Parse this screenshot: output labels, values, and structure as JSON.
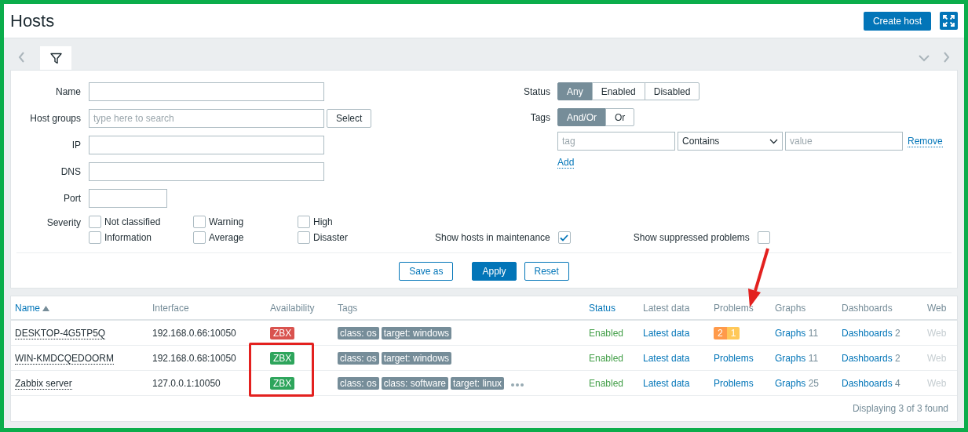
{
  "header": {
    "title": "Hosts",
    "create_button": "Create host"
  },
  "filter": {
    "fields": [
      {
        "label": "Name",
        "kind": "text"
      },
      {
        "label": "Host groups",
        "kind": "multiselect",
        "placeholder": "type here to search",
        "button": "Select"
      },
      {
        "label": "IP",
        "kind": "text"
      },
      {
        "label": "DNS",
        "kind": "text"
      },
      {
        "label": "Port",
        "kind": "short"
      }
    ],
    "severity": {
      "label": "Severity",
      "options": [
        {
          "label": "Not classified",
          "checked": false
        },
        {
          "label": "Warning",
          "checked": false
        },
        {
          "label": "High",
          "checked": false
        },
        {
          "label": "Information",
          "checked": false
        },
        {
          "label": "Average",
          "checked": false
        },
        {
          "label": "Disaster",
          "checked": false
        }
      ]
    },
    "status": {
      "label": "Status",
      "options": [
        {
          "label": "Any",
          "selected": true
        },
        {
          "label": "Enabled",
          "selected": false
        },
        {
          "label": "Disabled",
          "selected": false
        }
      ]
    },
    "tags": {
      "label": "Tags",
      "options": [
        {
          "label": "And/Or",
          "selected": true
        },
        {
          "label": "Or",
          "selected": false
        }
      ],
      "row": {
        "tag_placeholder": "tag",
        "operator": "Contains",
        "value_placeholder": "value",
        "remove": "Remove"
      },
      "add": "Add"
    },
    "maintenance": {
      "label": "Show hosts in maintenance",
      "checked": true
    },
    "suppressed": {
      "label": "Show suppressed problems",
      "checked": false
    },
    "buttons": [
      {
        "label": "Save as",
        "kind": "secondary"
      },
      {
        "label": "Apply",
        "kind": "primary"
      },
      {
        "label": "Reset",
        "kind": "secondary"
      }
    ]
  },
  "table": {
    "columns": [
      {
        "label": "Name",
        "sortable": true,
        "sorted": true
      },
      {
        "label": "Interface",
        "sortable": false,
        "sorted": false
      },
      {
        "label": "Availability",
        "sortable": false,
        "sorted": false
      },
      {
        "label": "Tags",
        "sortable": false,
        "sorted": false
      },
      {
        "label": "Status",
        "sortable": true,
        "sorted": false
      },
      {
        "label": "Latest data",
        "sortable": false,
        "sorted": false
      },
      {
        "label": "Problems",
        "sortable": false,
        "sorted": false
      },
      {
        "label": "Graphs",
        "sortable": false,
        "sorted": false
      },
      {
        "label": "Dashboards",
        "sortable": false,
        "sorted": false
      },
      {
        "label": "Web",
        "sortable": false,
        "sorted": false
      }
    ],
    "rows": [
      {
        "name": "DESKTOP-4G5TP5Q",
        "interface": "192.168.0.66:10050",
        "availability": {
          "label": "ZBX",
          "color": "#d9534f"
        },
        "tags": [
          "class: os",
          "target: windows"
        ],
        "more_tags": false,
        "status": "Enabled",
        "latest": "Latest data",
        "problems": {
          "kind": "counts",
          "counts": [
            {
              "value": "2",
              "color": "#ff9a4a"
            },
            {
              "value": "1",
              "color": "#ffc859"
            }
          ]
        },
        "graphs": {
          "label": "Graphs",
          "count": "11"
        },
        "dashboards": {
          "label": "Dashboards",
          "count": "2"
        },
        "web": {
          "label": "Web",
          "disabled": true
        }
      },
      {
        "name": "WIN-KMDCQEDOORM",
        "interface": "192.168.0.68:10050",
        "availability": {
          "label": "ZBX",
          "color": "#2ea55c"
        },
        "tags": [
          "class: os",
          "target: windows"
        ],
        "more_tags": false,
        "status": "Enabled",
        "latest": "Latest data",
        "problems": {
          "kind": "link",
          "label": "Problems"
        },
        "graphs": {
          "label": "Graphs",
          "count": "11"
        },
        "dashboards": {
          "label": "Dashboards",
          "count": "2"
        },
        "web": {
          "label": "Web",
          "disabled": true
        }
      },
      {
        "name": "Zabbix server",
        "interface": "127.0.0.1:10050",
        "availability": {
          "label": "ZBX",
          "color": "#2ea55c"
        },
        "tags": [
          "class: os",
          "class: software",
          "target: linux"
        ],
        "more_tags": true,
        "status": "Enabled",
        "latest": "Latest data",
        "problems": {
          "kind": "link",
          "label": "Problems"
        },
        "graphs": {
          "label": "Graphs",
          "count": "25"
        },
        "dashboards": {
          "label": "Dashboards",
          "count": "4"
        },
        "web": {
          "label": "Web",
          "disabled": true
        }
      }
    ],
    "footer": "Displaying 3 of 3 found"
  }
}
